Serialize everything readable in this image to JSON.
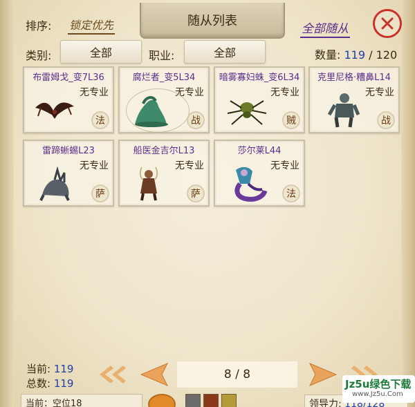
{
  "header": {
    "sort_label": "排序:",
    "sort_value": "锁定优先",
    "title": "随从列表",
    "follow_all": "全部随从",
    "category_label": "类别:",
    "category_value": "全部",
    "profession_label": "职业:",
    "profession_value": "全部",
    "count_label": "数量:",
    "count_current": "119",
    "count_sep": " / ",
    "count_max": "120"
  },
  "followers": [
    {
      "name": "布雷姆戈_变7L36",
      "spec": "无专业",
      "class": "法",
      "icon": "bat-wyvern-icon"
    },
    {
      "name": "腐烂者_变5L34",
      "spec": "无专业",
      "class": "战",
      "icon": "slime-rot-icon"
    },
    {
      "name": "暗雾寡妇蛛_变6L34",
      "spec": "无专业",
      "class": "贼",
      "icon": "spider-icon"
    },
    {
      "name": "克里尼格·糟鼻L14",
      "spec": "无专业",
      "class": "战",
      "icon": "ogre-icon"
    },
    {
      "name": "雷蹄蜥蜴L23",
      "spec": "无专业",
      "class": "萨",
      "icon": "lizard-icon"
    },
    {
      "name": "船医金吉尔L13",
      "spec": "无专业",
      "class": "萨",
      "icon": "beast-doctor-icon"
    },
    {
      "name": "莎尔莱L44",
      "spec": "无专业",
      "class": "法",
      "icon": "naga-icon"
    }
  ],
  "bottom": {
    "current_label": "当前:",
    "current_value": "119",
    "total_label": "总数:",
    "total_value": "119",
    "page": "8 / 8",
    "leader_label": "领导力:",
    "leader_value": "118/128",
    "strip_text": "当前：空位18"
  },
  "watermark": {
    "main": "Jz5u绿色下载",
    "sub": "www.Jz5u.Com"
  },
  "colors": {
    "parchment": "#efe5cb",
    "name_purple": "#5a2d8a",
    "value_blue": "#1d3fa8",
    "close_red": "#c8322a",
    "arrow_orange": "#e9a35a"
  }
}
